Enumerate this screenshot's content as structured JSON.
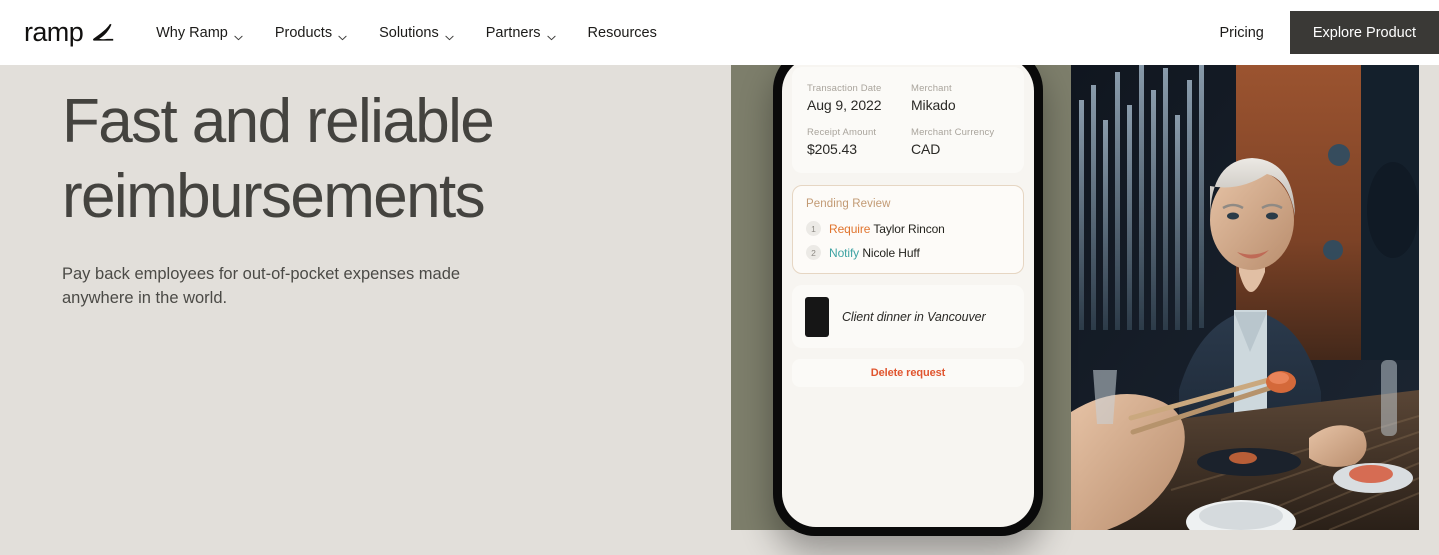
{
  "nav": {
    "brand": {
      "word": "ramp",
      "mark_icon": "ramp-swoosh-icon"
    },
    "links": [
      {
        "label": "Why Ramp",
        "has_chevron": true,
        "icon": "chevron-down-icon"
      },
      {
        "label": "Products",
        "has_chevron": true,
        "icon": "chevron-down-icon"
      },
      {
        "label": "Solutions",
        "has_chevron": true,
        "icon": "chevron-down-icon"
      },
      {
        "label": "Partners",
        "has_chevron": true,
        "icon": "chevron-down-icon"
      },
      {
        "label": "Resources",
        "has_chevron": false,
        "icon": ""
      }
    ],
    "pricing_label": "Pricing",
    "cta_label": "Explore Product",
    "cta_bg": "#3a3936",
    "bg": "#ffffff"
  },
  "hero": {
    "title": "Fast and reliable reimbursements",
    "subtitle": "Pay back employees for out-of-pocket expenses made anywhere in the world.",
    "bg": "#e2dfda",
    "title_color": "#44433f"
  },
  "media": {
    "panel_bg": "#7d7e6b",
    "photo_alt": "Smiling woman with short gray hair in a dark blazer at a restaurant dinner with chopsticks and sushi"
  },
  "phone": {
    "transaction": {
      "fields": [
        {
          "label": "Transaction Date",
          "value": "Aug 9, 2022"
        },
        {
          "label": "Merchant",
          "value": "Mikado"
        },
        {
          "label": "Receipt Amount",
          "value": "$205.43"
        },
        {
          "label": "Merchant Currency",
          "value": "CAD"
        }
      ]
    },
    "review": {
      "heading": "Pending Review",
      "heading_color": "#c29a74",
      "rows": [
        {
          "num": "1",
          "action": "Require",
          "action_color": "#e0752f",
          "person": "Taylor Rincon"
        },
        {
          "num": "2",
          "action": "Notify",
          "action_color": "#3fa3a3",
          "person": "Nicole Huff"
        }
      ]
    },
    "receipt": {
      "label": "Client dinner in Vancouver",
      "thumb_icon": "receipt-photo-icon"
    },
    "delete": {
      "label": "Delete request",
      "color": "#e0552f"
    }
  }
}
